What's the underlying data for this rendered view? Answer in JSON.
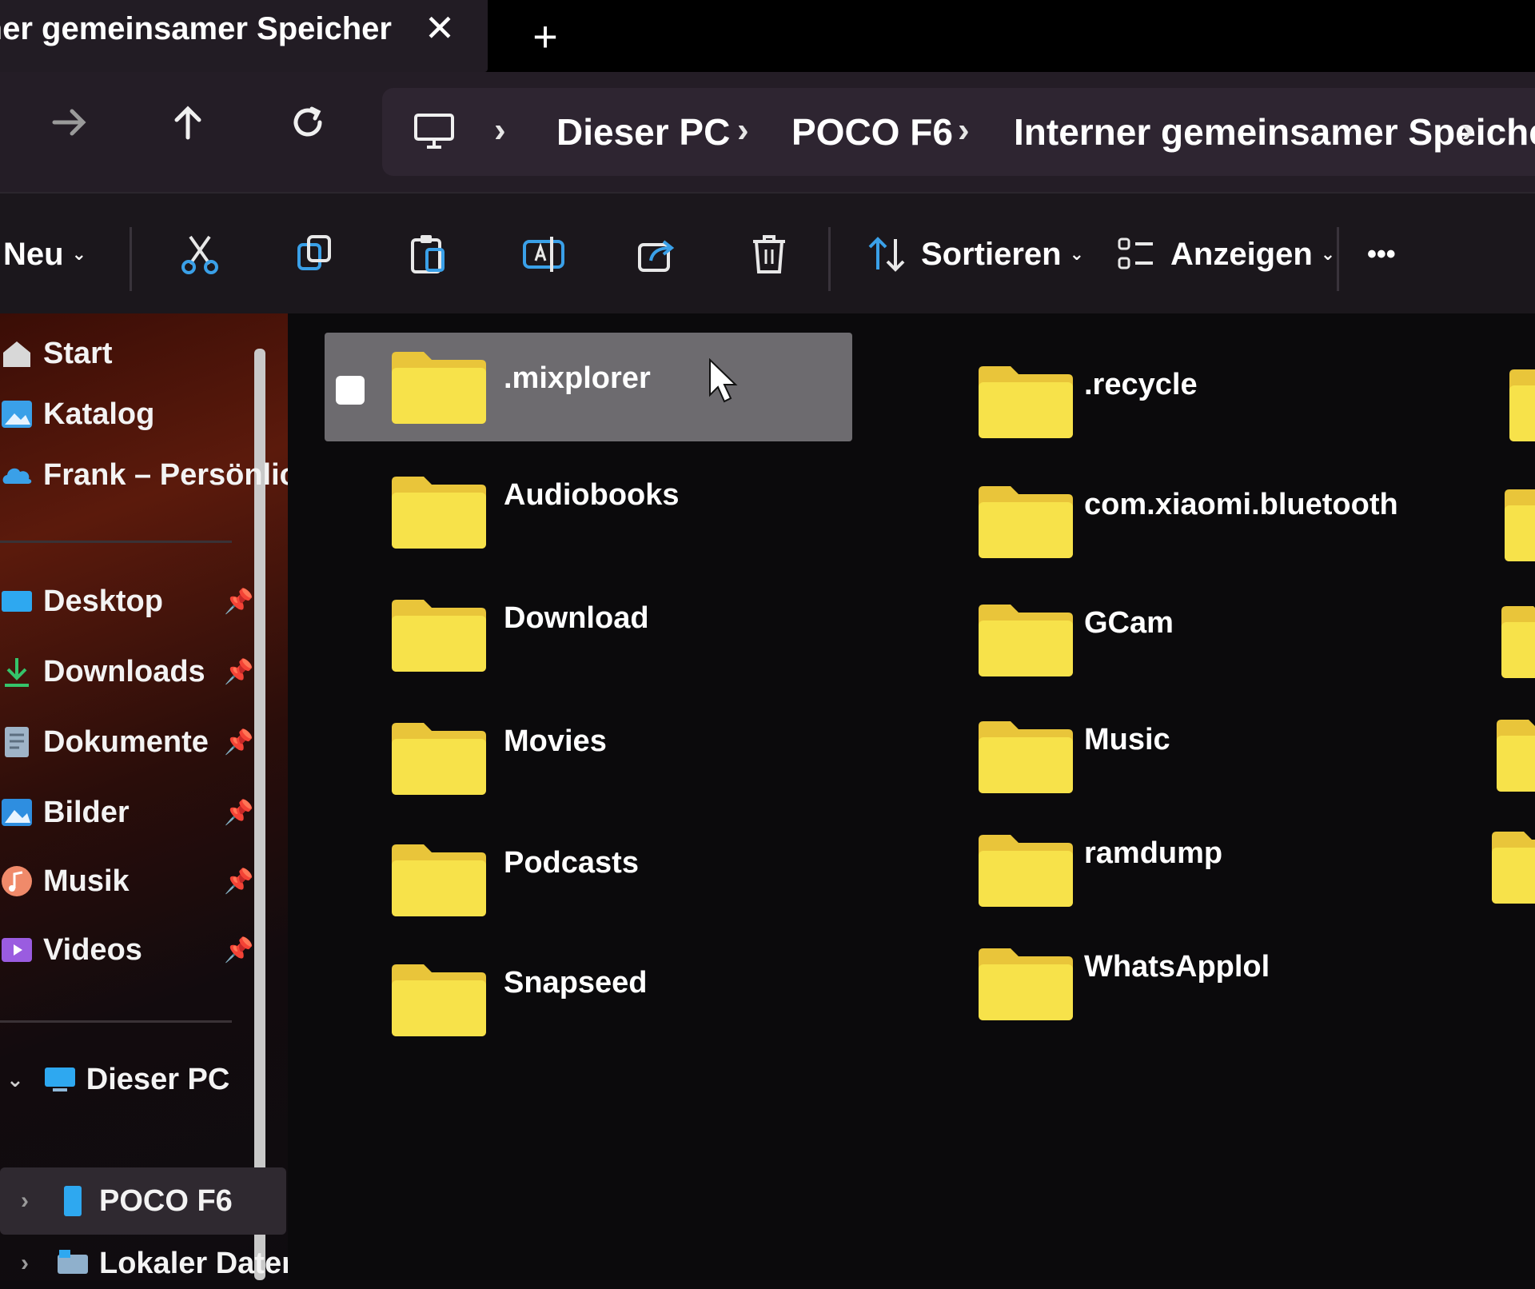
{
  "tab": {
    "title": "Interner gemeinsamer Speicher",
    "close_symbol": "✕",
    "new_tab_symbol": "+"
  },
  "nav": {
    "forward_icon": "arrow-right-icon",
    "up_icon": "arrow-up-icon",
    "refresh_icon": "refresh-icon",
    "breadcrumbs": [
      "Dieser PC",
      "POCO F6",
      "Interner gemeinsamer Speicher"
    ]
  },
  "toolbar": {
    "new_label": "Neu",
    "sort_label": "Sortieren",
    "view_label": "Anzeigen",
    "more_label": "•••",
    "icons": [
      "cut-icon",
      "copy-icon",
      "paste-icon",
      "rename-icon",
      "share-icon",
      "delete-icon"
    ]
  },
  "sidebar": {
    "top": [
      {
        "label": "Start",
        "icon": "home-icon"
      },
      {
        "label": "Katalog",
        "icon": "gallery-icon"
      },
      {
        "label": "Frank – Persönlic",
        "icon": "onedrive-cloud-icon"
      }
    ],
    "pinned": [
      {
        "label": "Desktop",
        "icon": "desktop-icon"
      },
      {
        "label": "Downloads",
        "icon": "download-icon"
      },
      {
        "label": "Dokumente",
        "icon": "documents-icon"
      },
      {
        "label": "Bilder",
        "icon": "pictures-icon"
      },
      {
        "label": "Musik",
        "icon": "music-icon"
      },
      {
        "label": "Videos",
        "icon": "videos-icon"
      }
    ],
    "pin_symbol": "📌",
    "tree": [
      {
        "label": "Dieser PC",
        "icon": "computer-icon"
      },
      {
        "label": "POCO F6",
        "icon": "phone-icon"
      },
      {
        "label": "Lokaler Datentr",
        "icon": "drive-icon"
      }
    ]
  },
  "folders": {
    "column1": [
      ".mixplorer",
      "Audiobooks",
      "Download",
      "Movies",
      "Podcasts",
      "Snapseed"
    ],
    "column2": [
      ".recycle",
      "com.xiaomi.bluetooth",
      "GCam",
      "Music",
      "ramdump",
      "WhatsApplol"
    ],
    "selected": ".mixplorer"
  },
  "colors": {
    "folder_yellow": "#f7e24a",
    "accent_blue": "#3aa0e8",
    "selection_gray": "#6d6b6f"
  }
}
